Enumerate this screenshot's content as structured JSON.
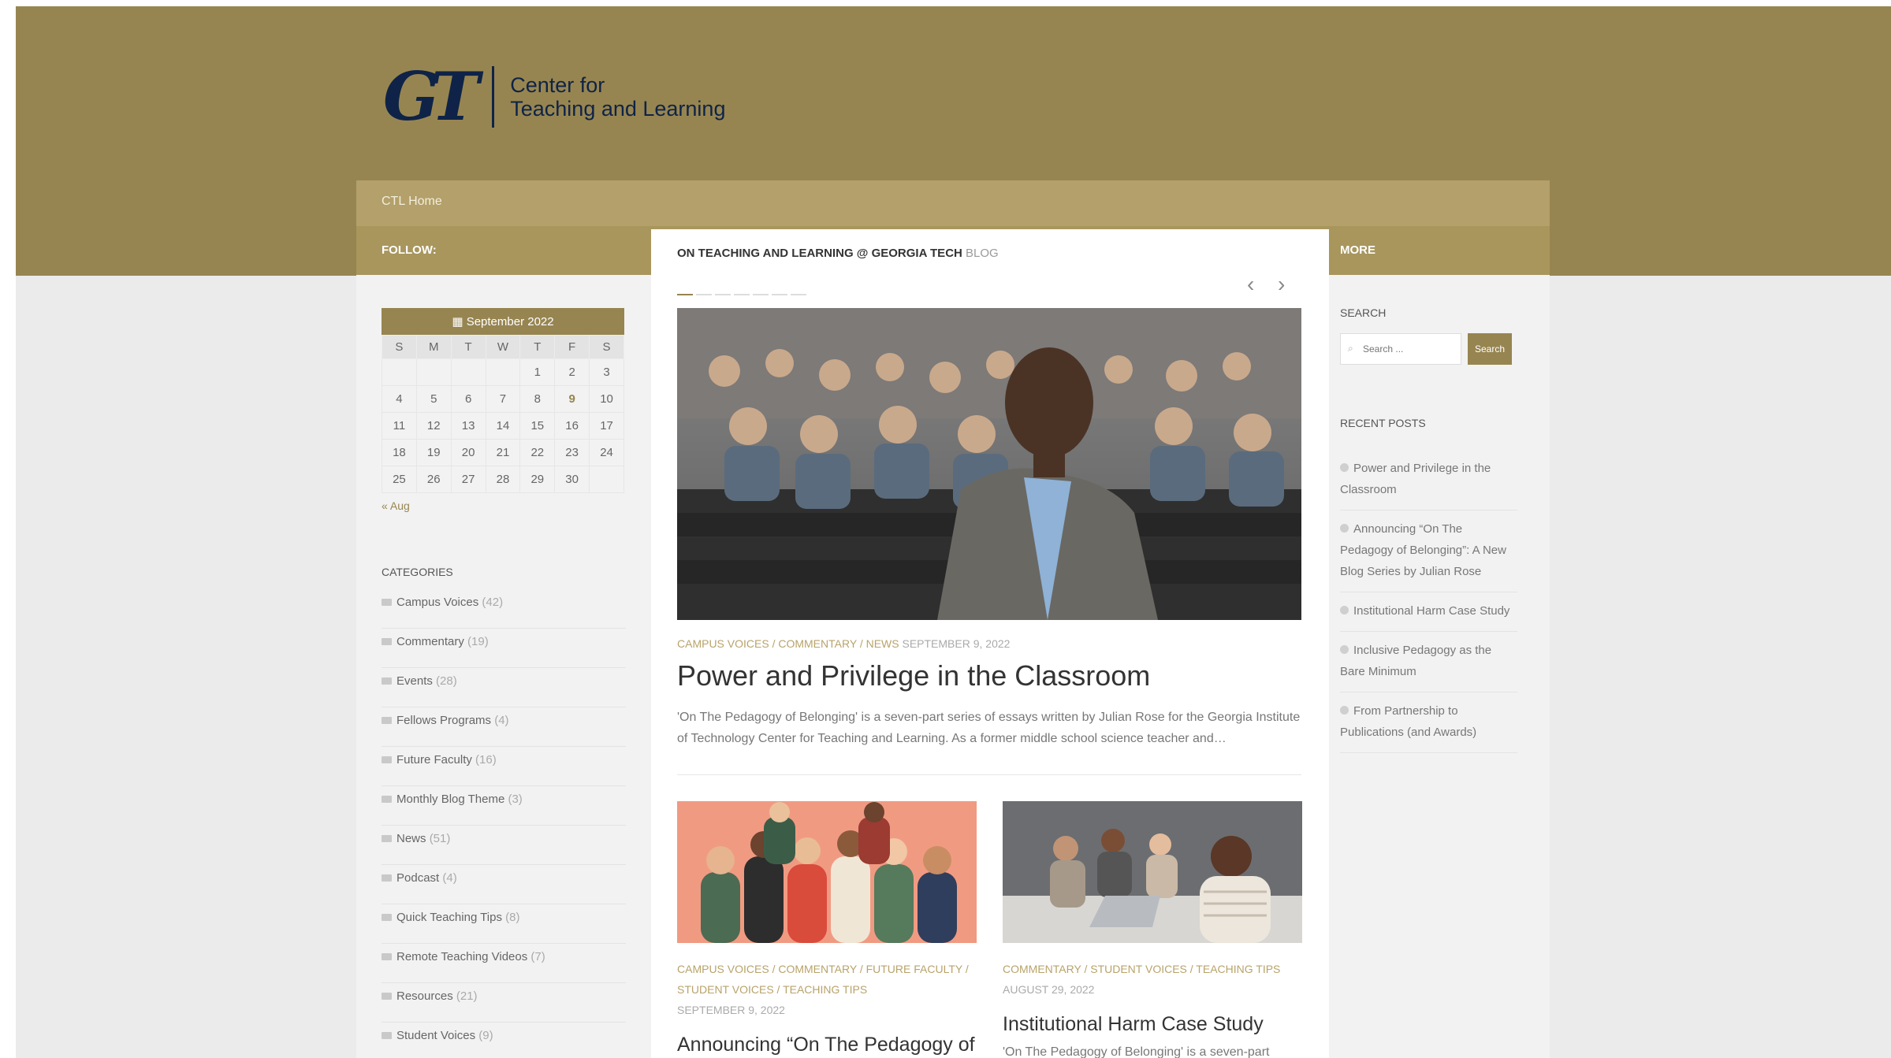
{
  "logo": {
    "monogram": "GT",
    "line1": "Center for",
    "line2": "Teaching and Learning"
  },
  "nav": {
    "home": "CTL Home"
  },
  "subbar": {
    "follow": "FOLLOW:",
    "more": "MORE"
  },
  "calendar": {
    "month": "September 2022",
    "weekdays": [
      "S",
      "M",
      "T",
      "W",
      "T",
      "F",
      "S"
    ],
    "weeks": [
      [
        "",
        "",
        "",
        "",
        "1",
        "2",
        "3"
      ],
      [
        "4",
        "5",
        "6",
        "7",
        "8",
        "9",
        "10"
      ],
      [
        "11",
        "12",
        "13",
        "14",
        "15",
        "16",
        "17"
      ],
      [
        "18",
        "19",
        "20",
        "21",
        "22",
        "23",
        "24"
      ],
      [
        "25",
        "26",
        "27",
        "28",
        "29",
        "30",
        ""
      ]
    ],
    "linked_day": "9",
    "prev_link": "« Aug"
  },
  "categories": {
    "title": "CATEGORIES",
    "items": [
      {
        "name": "Campus Voices",
        "count": "(42)"
      },
      {
        "name": "Commentary",
        "count": "(19)"
      },
      {
        "name": "Events",
        "count": "(28)"
      },
      {
        "name": "Fellows Programs",
        "count": "(4)"
      },
      {
        "name": "Future Faculty",
        "count": "(16)"
      },
      {
        "name": "Monthly Blog Theme",
        "count": "(3)"
      },
      {
        "name": "News",
        "count": "(51)"
      },
      {
        "name": "Podcast",
        "count": "(4)"
      },
      {
        "name": "Quick Teaching Tips",
        "count": "(8)"
      },
      {
        "name": "Remote Teaching Videos",
        "count": "(7)"
      },
      {
        "name": "Resources",
        "count": "(21)"
      },
      {
        "name": "Student Voices",
        "count": "(9)"
      }
    ]
  },
  "main": {
    "heading": "ON TEACHING AND LEARNING @ GEORGIA TECH",
    "heading_suffix": "BLOG",
    "prev_arrow": "‹",
    "next_arrow": "›",
    "featured": {
      "categories": "CAMPUS VOICES / COMMENTARY / NEWS",
      "date": "SEPTEMBER 9, 2022",
      "title": "Power and Privilege in the Classroom",
      "excerpt": "'On The Pedagogy of Belonging' is a seven-part series of essays written by Julian Rose for the Georgia Institute of Technology Center for Teaching and Learning. As a former middle school science teacher and…"
    },
    "card1": {
      "categories_line1": "CAMPUS VOICES / COMMENTARY / FUTURE FACULTY /",
      "categories_line2": "STUDENT VOICES / TEACHING TIPS",
      "date": "SEPTEMBER 9, 2022",
      "title": "Announcing “On The Pedagogy of Belonging”: A New Blog Series by"
    },
    "card2": {
      "categories": "COMMENTARY / STUDENT VOICES / TEACHING TIPS",
      "date": "AUGUST 29, 2022",
      "title": "Institutional Harm Case Study",
      "excerpt": "'On The Pedagogy of Belonging' is a seven-part"
    }
  },
  "sidebar_right": {
    "search_label": "SEARCH",
    "search_placeholder": "Search ...",
    "search_button": "Search",
    "recent_label": "RECENT POSTS",
    "recent": [
      "Power and Privilege in the Classroom",
      "Announcing “On The Pedagogy of Belonging”: A New Blog Series by Julian Rose",
      "Institutional Harm Case Study",
      "Inclusive Pedagogy as the Bare Minimum",
      "From Partnership to Publications (and Awards)"
    ]
  },
  "colors": {
    "gold": "#978551",
    "gold_light": "#b3a06a",
    "navy": "#0e2347"
  }
}
